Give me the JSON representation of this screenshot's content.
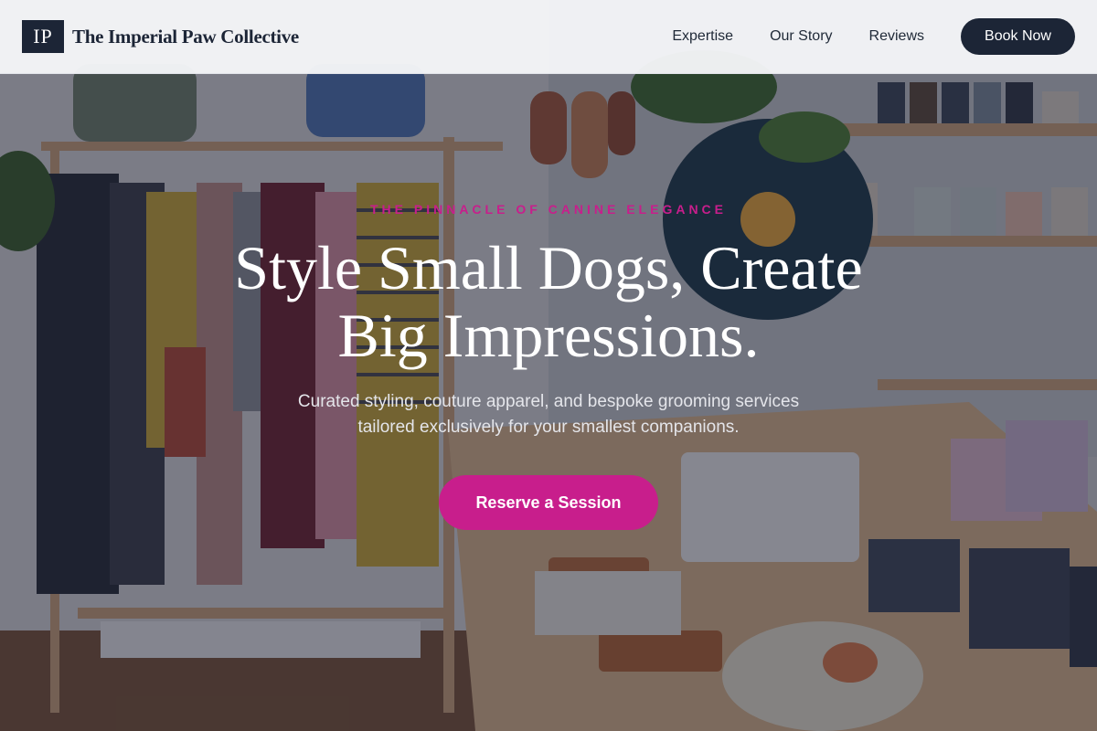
{
  "brand": {
    "monogram": "IP",
    "name": "The Imperial Paw Collective"
  },
  "nav": {
    "items": [
      {
        "label": "Expertise"
      },
      {
        "label": "Our Story"
      },
      {
        "label": "Reviews"
      }
    ],
    "book_label": "Book Now"
  },
  "hero": {
    "eyebrow": "THE PINNACLE OF CANINE ELEGANCE",
    "headline_line1": "Style Small Dogs, Create",
    "headline_line2": "Big Impressions.",
    "subtitle_line1": "Curated styling, couture apparel, and bespoke grooming services",
    "subtitle_line2": "tailored exclusively for your smallest companions.",
    "cta_label": "Reserve a Session",
    "background_image": "boutique-interior-photo"
  },
  "colors": {
    "brand_dark": "#1c2536",
    "accent": "#c81e8c",
    "header_bg": "#f5f6f8"
  }
}
